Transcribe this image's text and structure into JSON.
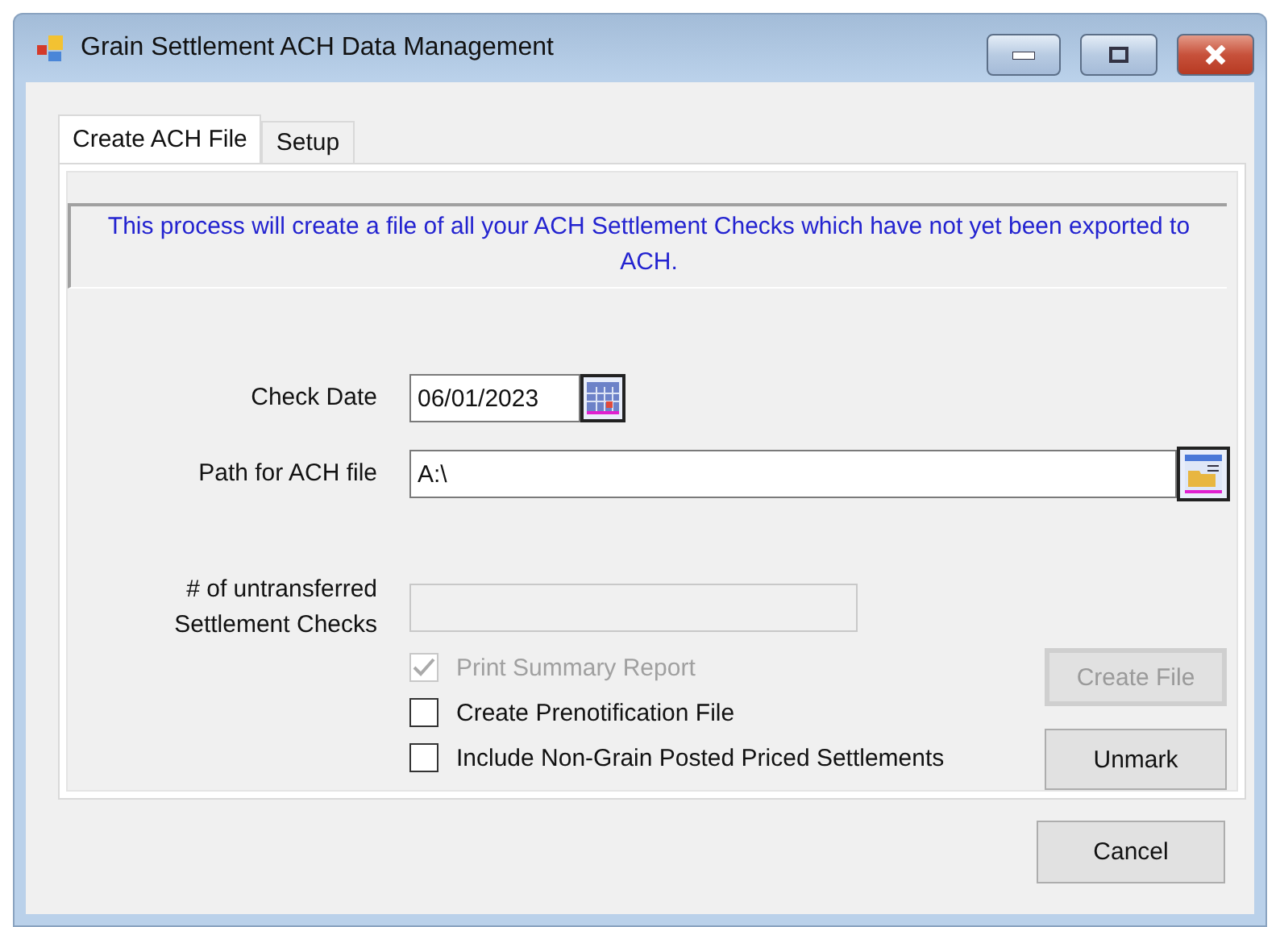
{
  "window": {
    "title": "Grain Settlement ACH Data Management"
  },
  "tabs": [
    {
      "label": "Create ACH File",
      "selected": true
    },
    {
      "label": "Setup",
      "selected": false
    }
  ],
  "message": "This process will create a file of all  your ACH Settlement Checks which have not yet been exported to ACH.",
  "check_date": {
    "label": "Check Date",
    "value": "06/01/2023"
  },
  "path": {
    "label": "Path for ACH file",
    "value": "A:\\"
  },
  "untransferred": {
    "label": "# of untransferred Settlement Checks",
    "disabled": true
  },
  "options": [
    {
      "label": "Print Summary Report",
      "checked": true,
      "disabled": true
    },
    {
      "label": "Create Prenotification File",
      "checked": false,
      "disabled": false
    },
    {
      "label": "Include Non-Grain Posted Priced Settlements",
      "checked": false,
      "disabled": false
    }
  ],
  "side_buttons": [
    {
      "label": "Create File",
      "disabled": true
    },
    {
      "label": "Unmark",
      "disabled": false
    }
  ],
  "cancel_button": {
    "label": "Cancel"
  }
}
